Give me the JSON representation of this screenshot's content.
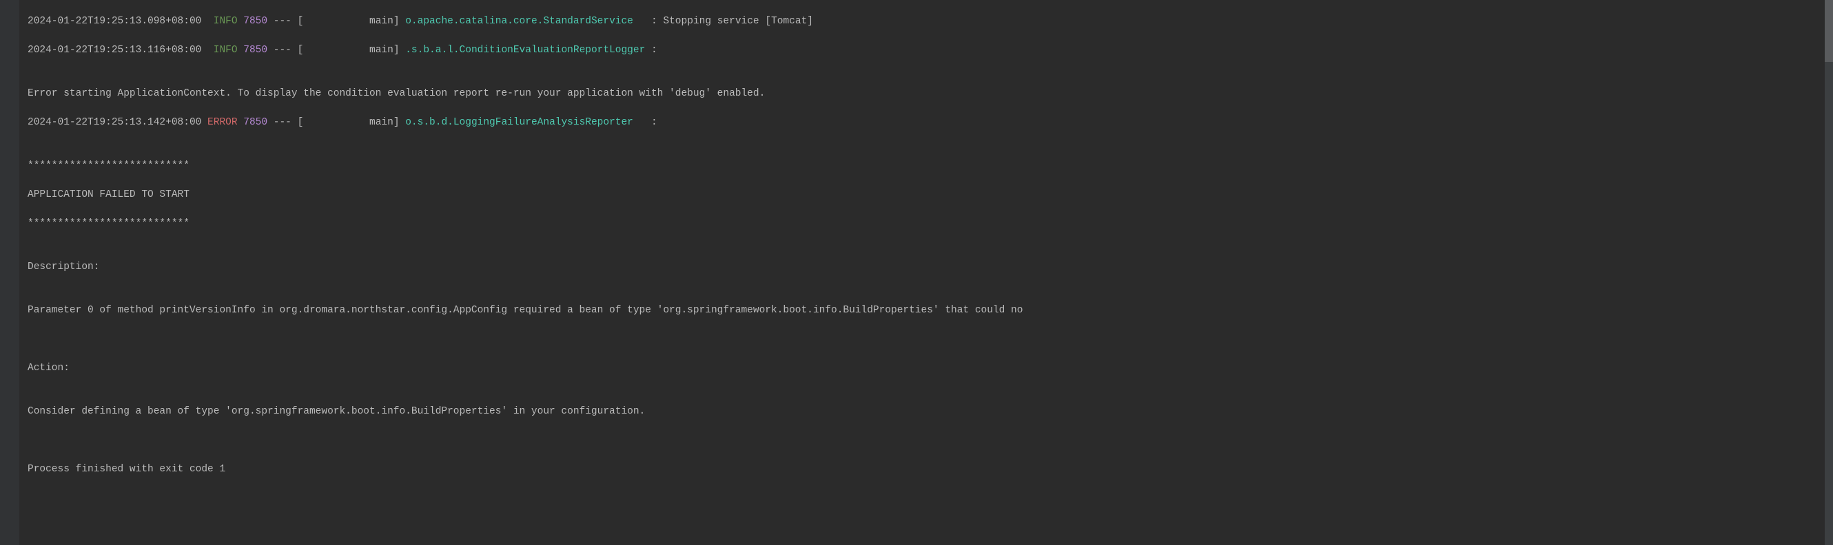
{
  "log": {
    "lines": [
      {
        "ts": "2024-01-22T19:25:13.098+08:00",
        "level": "INFO",
        "pid": "7850",
        "sep": "---",
        "thread_open": "[",
        "thread_pad": "           main",
        "thread_close": "]",
        "logger": "o.apache.catalina.core.StandardService  ",
        "colon": ":",
        "msg": " Stopping service [Tomcat]"
      },
      {
        "ts": "2024-01-22T19:25:13.116+08:00",
        "level": "INFO",
        "pid": "7850",
        "sep": "---",
        "thread_open": "[",
        "thread_pad": "           main",
        "thread_close": "]",
        "logger": ".s.b.a.l.ConditionEvaluationReportLogger",
        "colon": ":",
        "msg": ""
      }
    ],
    "blank1": "",
    "error_context": "Error starting ApplicationContext. To display the condition evaluation report re-run your application with 'debug' enabled.",
    "error_line": {
      "ts": "2024-01-22T19:25:13.142+08:00",
      "level": "ERROR",
      "pid": "7850",
      "sep": "---",
      "thread_open": "[",
      "thread_pad": "           main",
      "thread_close": "]",
      "logger": "o.s.b.d.LoggingFailureAnalysisReporter  ",
      "colon": ":",
      "msg": ""
    },
    "blank2": "",
    "border_top": "***************************",
    "fail_header": "APPLICATION FAILED TO START",
    "border_bot": "***************************",
    "blank3": "",
    "desc_label": "Description:",
    "blank4": "",
    "desc_text": "Parameter 0 of method printVersionInfo in org.dromara.northstar.config.AppConfig required a bean of type 'org.springframework.boot.info.BuildProperties' that could no",
    "blank5": "",
    "blank6": "",
    "action_label": "Action:",
    "blank7": "",
    "action_text": "Consider defining a bean of type 'org.springframework.boot.info.BuildProperties' in your configuration.",
    "blank8": "",
    "blank9": "",
    "exit_text": "Process finished with exit code 1"
  }
}
